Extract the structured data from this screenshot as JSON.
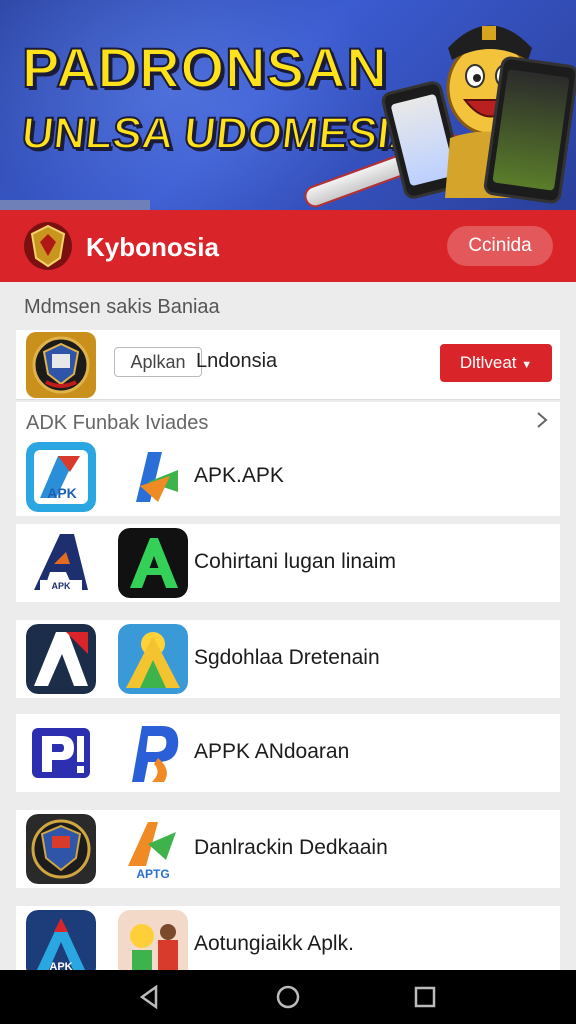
{
  "banner": {
    "title": "PADRONSAN",
    "subtitle": "UNLSA UDOMESIA"
  },
  "header": {
    "app_title": "Kybonosia",
    "action_label": "Ccinida"
  },
  "section_caption": "Mdmsen sakis Baniaa",
  "featured": {
    "tag": "Aplkan",
    "name": "Lndonsia",
    "button_label": "Dltlveat"
  },
  "list": {
    "title": "ADK Funbak Iviades",
    "apps": [
      {
        "name": "APK.APK",
        "icon_a": "apk-blue-icon",
        "icon_b": "arrow-logo-icon"
      },
      {
        "name": "Cohirtani lugan linaim",
        "icon_a": "a-logo-icon",
        "icon_b": "a-green-icon"
      },
      {
        "name": "Sgdohlaa Dretenain",
        "icon_a": "a-red-icon",
        "icon_b": "a-sun-icon"
      },
      {
        "name": "APPK ANdoaran",
        "icon_a": "p-icon",
        "icon_b": "p-swirl-icon"
      },
      {
        "name": "Danlrackin Dedkaain",
        "icon_a": "shield-icon",
        "icon_b": "apk-figure-icon"
      },
      {
        "name": "Aotungiaikk Aplk.",
        "icon_a": "apk-triangle-icon",
        "icon_b": "cartoon-icon"
      }
    ]
  },
  "icon_labels": {
    "apk_small": "APK",
    "apk_tag": "APTG",
    "apk_bottom": "APK"
  },
  "colors": {
    "header_red": "#d9242a",
    "banner_blue": "#3b5bd0",
    "banner_yellow": "#ffe21a"
  },
  "navbar": {
    "back": "back-icon",
    "home": "home-icon",
    "recents": "recents-icon"
  }
}
